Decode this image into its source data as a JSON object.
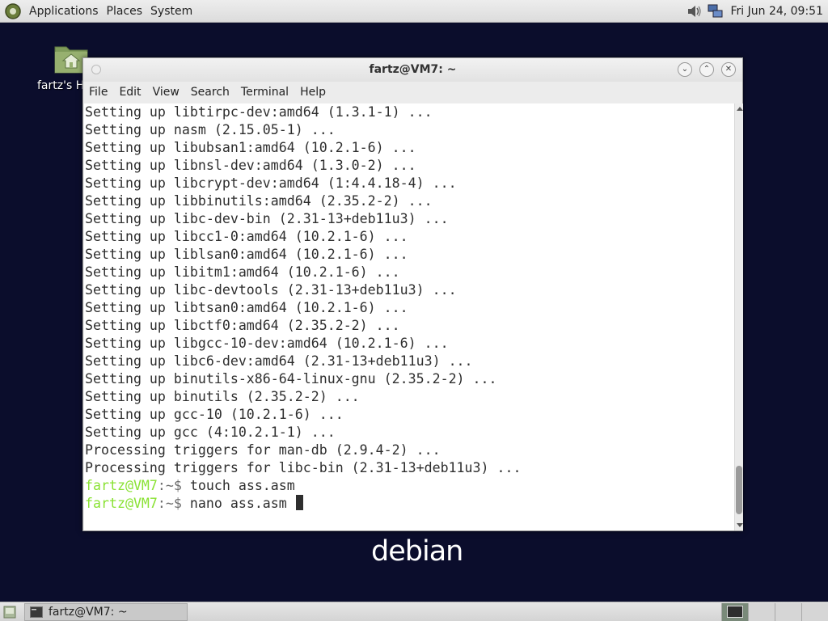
{
  "top_panel": {
    "menus": [
      "Applications",
      "Places",
      "System"
    ],
    "clock": "Fri Jun 24, 09:51"
  },
  "desktop": {
    "home_icon_label": "fartz's Home",
    "logo_text": "debian"
  },
  "window": {
    "title": "fartz@VM7: ~",
    "menu": [
      "File",
      "Edit",
      "View",
      "Search",
      "Terminal",
      "Help"
    ]
  },
  "terminal": {
    "output_lines": [
      "Setting up libtirpc-dev:amd64 (1.3.1-1) ...",
      "Setting up nasm (2.15.05-1) ...",
      "Setting up libubsan1:amd64 (10.2.1-6) ...",
      "Setting up libnsl-dev:amd64 (1.3.0-2) ...",
      "Setting up libcrypt-dev:amd64 (1:4.4.18-4) ...",
      "Setting up libbinutils:amd64 (2.35.2-2) ...",
      "Setting up libc-dev-bin (2.31-13+deb11u3) ...",
      "Setting up libcc1-0:amd64 (10.2.1-6) ...",
      "Setting up liblsan0:amd64 (10.2.1-6) ...",
      "Setting up libitm1:amd64 (10.2.1-6) ...",
      "Setting up libc-devtools (2.31-13+deb11u3) ...",
      "Setting up libtsan0:amd64 (10.2.1-6) ...",
      "Setting up libctf0:amd64 (2.35.2-2) ...",
      "Setting up libgcc-10-dev:amd64 (10.2.1-6) ...",
      "Setting up libc6-dev:amd64 (2.31-13+deb11u3) ...",
      "Setting up binutils-x86-64-linux-gnu (2.35.2-2) ...",
      "Setting up binutils (2.35.2-2) ...",
      "Setting up gcc-10 (10.2.1-6) ...",
      "Setting up gcc (4:10.2.1-1) ...",
      "Processing triggers for man-db (2.9.4-2) ...",
      "Processing triggers for libc-bin (2.31-13+deb11u3) ..."
    ],
    "prompts": [
      {
        "user": "fartz@VM7",
        "path": ":~$ ",
        "command": "touch ass.asm"
      },
      {
        "user": "fartz@VM7",
        "path": ":~$ ",
        "command": "nano ass.asm "
      }
    ]
  },
  "bottom_panel": {
    "task_label": "fartz@VM7: ~"
  }
}
